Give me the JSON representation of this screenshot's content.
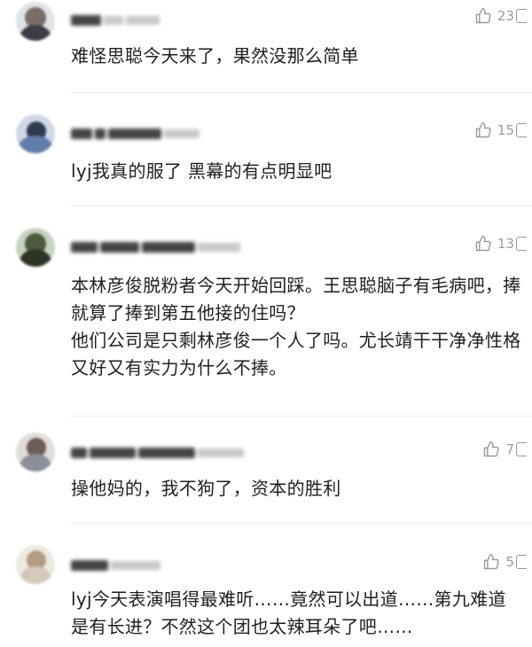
{
  "comments": [
    {
      "text": "难怪思聪今天来了，果然没那么简单",
      "likes": "23"
    },
    {
      "text": "lyj我真的服了 黑幕的有点明显吧",
      "likes": "15"
    },
    {
      "text": "本林彦俊脱粉者今天开始回踩。王思聪脑子有毛病吧，捧就算了捧到第五他接的住吗？\n他们公司是只剩林彦俊一个人了吗。尤长靖干干净净性格又好又有实力为什么不捧。",
      "likes": "13"
    },
    {
      "text": "操他妈的，我不狗了，资本的胜利",
      "likes": "7"
    },
    {
      "text": "lyj今天表演唱得最难听……竟然可以出道……第九难道是有长进？不然这个团也太辣耳朵了吧……",
      "likes": "5"
    }
  ],
  "icons": {
    "like": "thumbs-up-icon",
    "reply": "comment-icon"
  },
  "colors": {
    "text": "#1f1f1f",
    "meta": "#9a9a9a",
    "divider": "#ececec"
  }
}
